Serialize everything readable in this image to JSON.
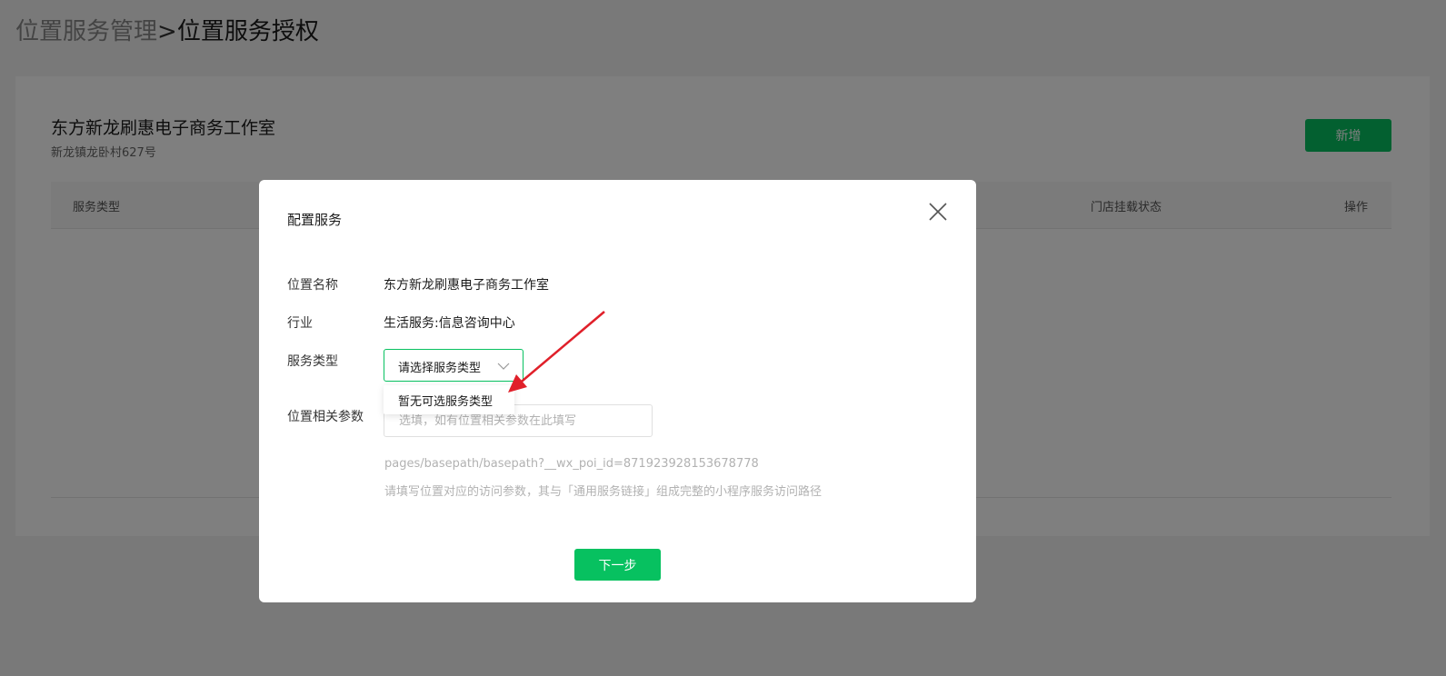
{
  "breadcrumb": {
    "parent": "位置服务管理",
    "separator": ">",
    "current": "位置服务授权"
  },
  "store": {
    "name": "东方新龙刷惠电子商务工作室",
    "address": "新龙镇龙卧村627号"
  },
  "add_button": "新增",
  "table": {
    "headers": [
      "服务类型",
      "门店挂载状态",
      "操作"
    ]
  },
  "dialog": {
    "title": "配置服务",
    "location_name_label": "位置名称",
    "location_name_value": "东方新龙刷惠电子商务工作室",
    "industry_label": "行业",
    "industry_value": "生活服务:信息咨询中心",
    "service_type_label": "服务类型",
    "service_type_placeholder": "请选择服务类型",
    "service_type_dropdown_empty": "暂无可选服务类型",
    "params_label": "位置相关参数",
    "params_placeholder": "选填，如有位置相关参数在此填写",
    "hint_path": "pages/basepath/basepath?__wx_poi_id=871923928153678778",
    "hint_desc": "请填写位置对应的访问参数，其与「通用服务链接」组成完整的小程序服务访问路径",
    "next_button": "下一步"
  },
  "colors": {
    "brand_green": "#07c160",
    "annotation_arrow": "#e0202a"
  },
  "icons": [
    "close-icon",
    "chevron-down-icon",
    "annotation-arrow"
  ]
}
